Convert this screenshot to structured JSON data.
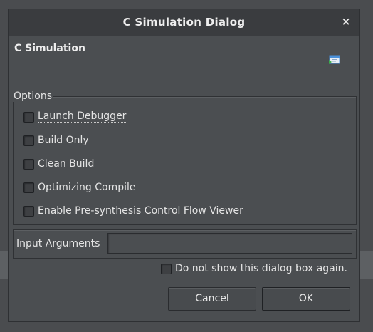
{
  "window": {
    "title": "C Simulation Dialog",
    "close_glyph": "×"
  },
  "header": {
    "label": "C Simulation",
    "icon": "simulation-window-icon"
  },
  "options": {
    "legend": "Options",
    "items": [
      {
        "label": "Launch Debugger",
        "checked": false
      },
      {
        "label": "Build Only",
        "checked": false
      },
      {
        "label": "Clean Build",
        "checked": false
      },
      {
        "label": "Optimizing Compile",
        "checked": false
      },
      {
        "label": "Enable Pre-synthesis Control Flow Viewer",
        "checked": false
      }
    ]
  },
  "input_arguments": {
    "label": "Input Arguments",
    "value": ""
  },
  "do_not_show": {
    "label": "Do not show this dialog box again.",
    "checked": false
  },
  "buttons": {
    "cancel": "Cancel",
    "ok": "OK"
  },
  "colors": {
    "dialog_bg": "#4b4e51",
    "titlebar_bg": "#3a3c3f",
    "text": "#e4e4e4",
    "icon_blue": "#4a90d9",
    "icon_green": "#3cb04a"
  }
}
